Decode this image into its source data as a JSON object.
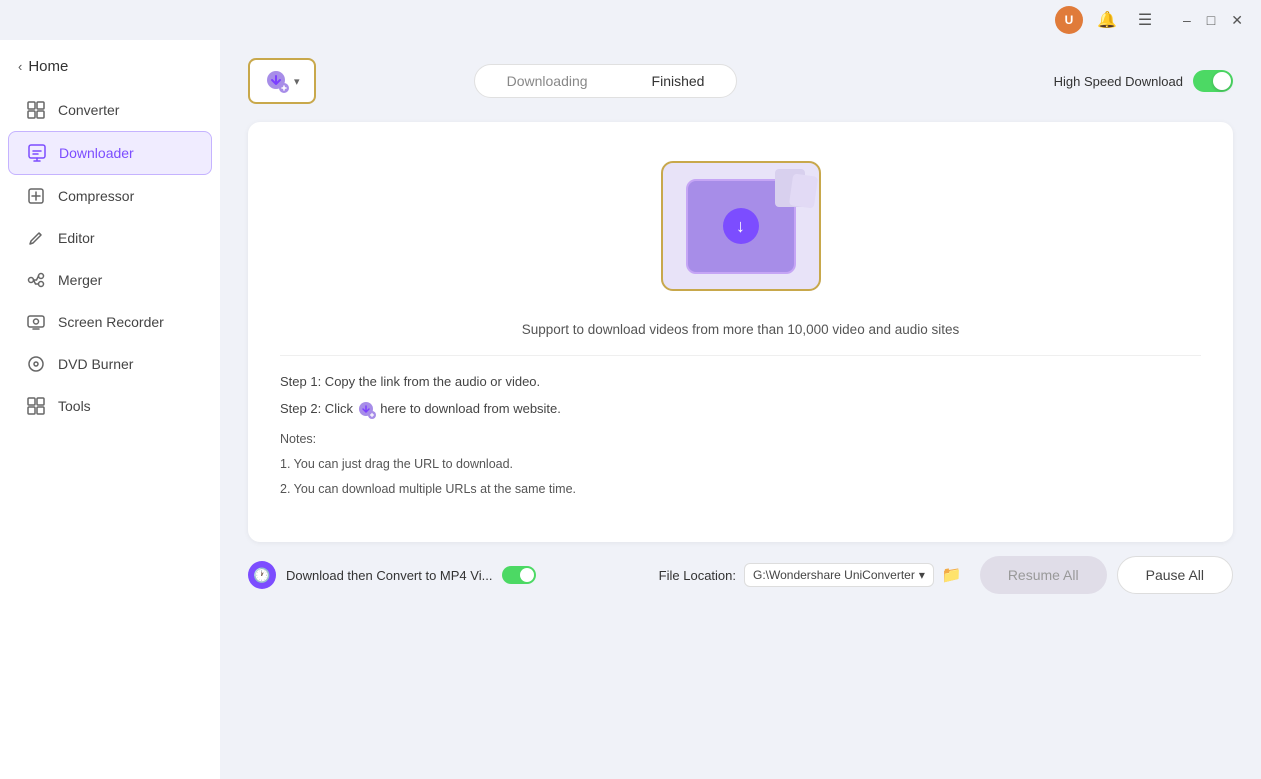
{
  "titlebar": {
    "user_icon": "U",
    "bell_label": "🔔",
    "menu_label": "☰",
    "minimize_label": "–",
    "maximize_label": "□",
    "close_label": "✕"
  },
  "sidebar": {
    "back_label": "Home",
    "items": [
      {
        "id": "converter",
        "label": "Converter",
        "icon": "⊞"
      },
      {
        "id": "downloader",
        "label": "Downloader",
        "icon": "⬇",
        "active": true
      },
      {
        "id": "compressor",
        "label": "Compressor",
        "icon": "⊡"
      },
      {
        "id": "editor",
        "label": "Editor",
        "icon": "✂"
      },
      {
        "id": "merger",
        "label": "Merger",
        "icon": "⊞"
      },
      {
        "id": "screen-recorder",
        "label": "Screen Recorder",
        "icon": "◎"
      },
      {
        "id": "dvd-burner",
        "label": "DVD Burner",
        "icon": "◎"
      },
      {
        "id": "tools",
        "label": "Tools",
        "icon": "⊞"
      }
    ]
  },
  "toolbar": {
    "add_button_label": "",
    "chevron": "▾",
    "tabs": [
      {
        "id": "downloading",
        "label": "Downloading",
        "active": false
      },
      {
        "id": "finished",
        "label": "Finished",
        "active": true
      }
    ],
    "speed_label": "High Speed Download",
    "speed_on": true
  },
  "card": {
    "support_text": "Support to download videos from more than 10,000 video and audio sites",
    "step1": "Step 1: Copy the link from the audio or video.",
    "step2_prefix": "Step 2: Click",
    "step2_suffix": "here to download from website.",
    "notes_title": "Notes:",
    "note1": "1. You can just drag the URL to download.",
    "note2": "2. You can download multiple URLs at the same time."
  },
  "bottom": {
    "convert_label": "Download then Convert to MP4 Vi...",
    "file_location_label": "File Location:",
    "location_value": "G:\\Wondershare UniConverter",
    "resume_label": "Resume All",
    "pause_label": "Pause All"
  }
}
